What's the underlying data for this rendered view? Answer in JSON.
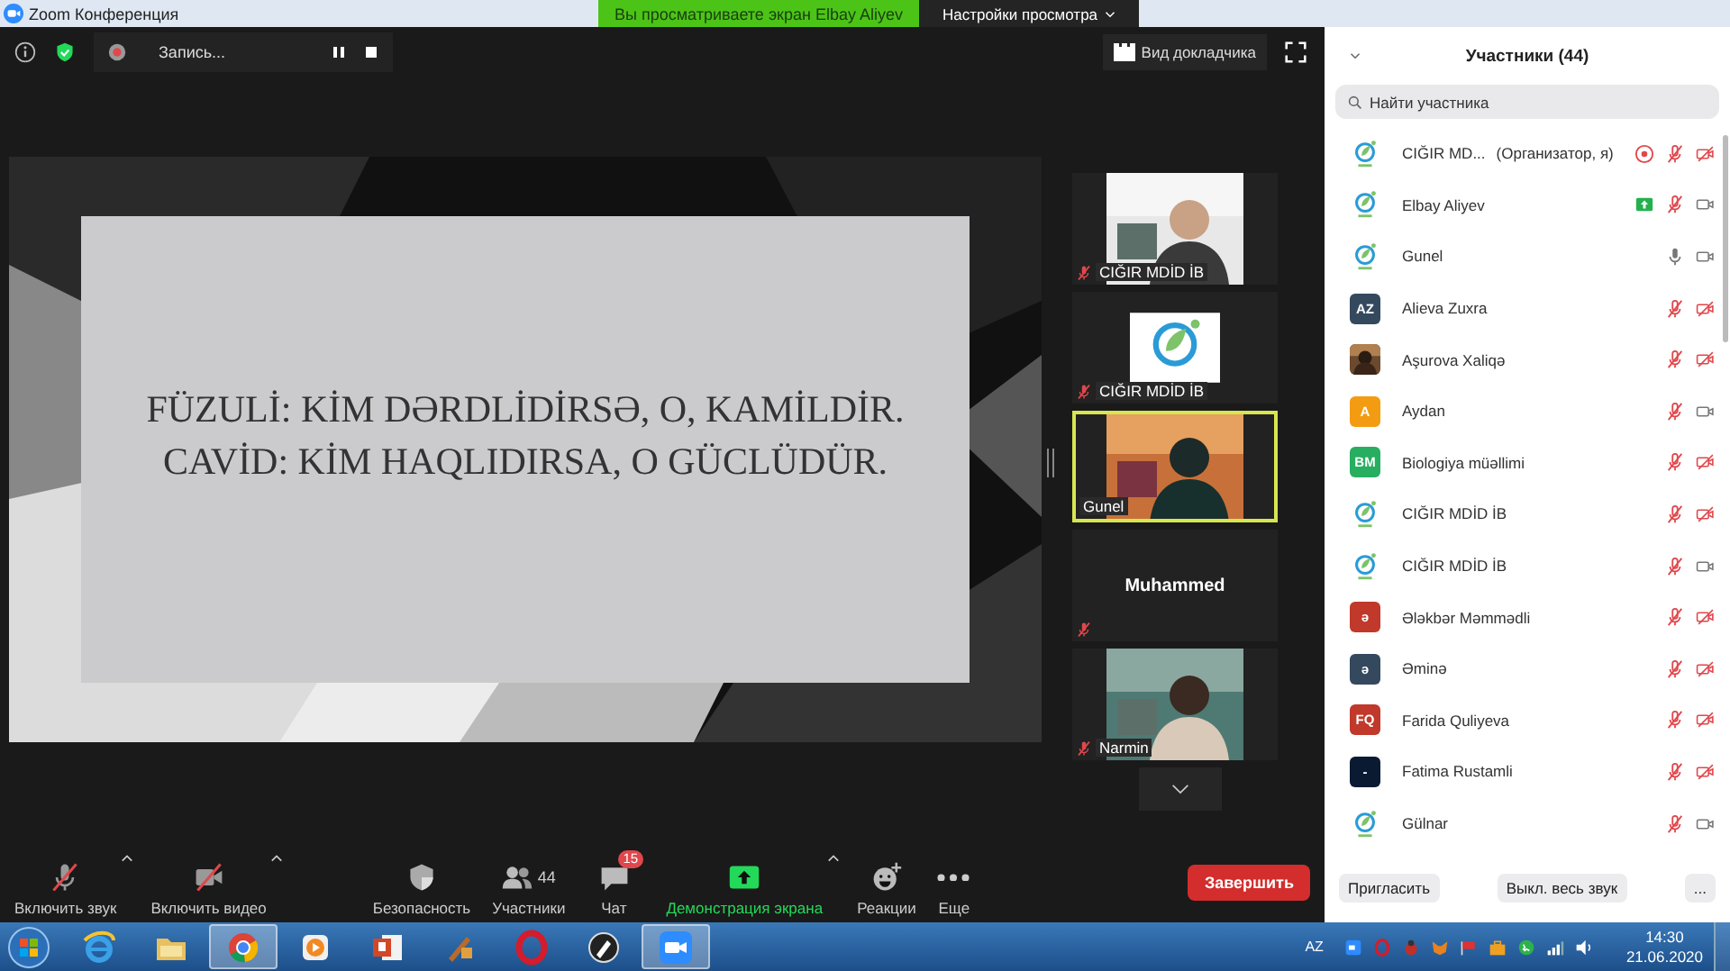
{
  "window": {
    "title": "Zoom Конференция"
  },
  "share_banner": {
    "text": "Вы просматриваете экран Elbay Aliyev",
    "view_options": "Настройки просмотра"
  },
  "meeting_bar": {
    "recording_label": "Запись...",
    "view_button": "Вид докладчика"
  },
  "shared_screen": {
    "lines": [
      "FÜZULİ: KİM DƏRDLİDİRSƏ, O, KAMİLDİR.",
      "CAVİD: KİM HAQLIDIRSA, O GÜCLÜDÜR."
    ]
  },
  "video_tiles": [
    {
      "kind": "video",
      "name": "CIĞIR MDİD İB",
      "muted": true,
      "active": false
    },
    {
      "kind": "logo",
      "name": "CIĞIR MDİD İB",
      "muted": true,
      "active": false
    },
    {
      "kind": "video",
      "name": "Gunel",
      "muted": false,
      "active": true
    },
    {
      "kind": "name",
      "name": "Muhammed",
      "muted": true,
      "active": false
    },
    {
      "kind": "video",
      "name": "Narmin",
      "muted": true,
      "active": false
    }
  ],
  "toolbar": [
    {
      "kind": "mic",
      "label": "Включить звук",
      "caret": true
    },
    {
      "kind": "camera",
      "label": "Включить видео",
      "caret": true
    },
    {
      "kind": "security",
      "label": "Безопасность",
      "caret": false
    },
    {
      "kind": "participants",
      "label": "Участники",
      "count": "44",
      "caret": false
    },
    {
      "kind": "chat",
      "label": "Чат",
      "badge": "15",
      "caret": false
    },
    {
      "kind": "share",
      "label": "Демонстрация экрана",
      "caret": true
    },
    {
      "kind": "reactions",
      "label": "Реакции",
      "caret": false
    },
    {
      "kind": "more",
      "label": "Еще",
      "caret": false
    }
  ],
  "end_button": "Завершить",
  "participants_panel": {
    "title": "Участники (44)",
    "search": {
      "placeholder": "Найти участника"
    },
    "items": [
      {
        "kind": "logo",
        "name": "CIĞIR MD...",
        "note": "(Организатор, я)",
        "recording": true,
        "sharing": false,
        "muted": true,
        "video_on": false
      },
      {
        "kind": "logo",
        "name": "Elbay Aliyev",
        "recording": false,
        "sharing": true,
        "muted": true,
        "video_on": true
      },
      {
        "kind": "logo",
        "name": "Gunel",
        "recording": false,
        "sharing": false,
        "muted": false,
        "video_on": true
      },
      {
        "kind": "initials",
        "initials": "AZ",
        "color": "#34495e",
        "name": "Alieva Zuxra",
        "recording": false,
        "sharing": false,
        "muted": true,
        "video_on": false
      },
      {
        "name": "Aşurova Xaliqə",
        "recording": false,
        "sharing": false,
        "muted": true,
        "video_on": false
      },
      {
        "kind": "initials",
        "initials": "A",
        "color": "#f39c12",
        "name": "Aydan",
        "recording": false,
        "sharing": false,
        "muted": true,
        "video_on": true
      },
      {
        "kind": "initials",
        "initials": "BM",
        "color": "#27ae60",
        "name": "Biologiya müəllimi",
        "recording": false,
        "sharing": false,
        "muted": true,
        "video_on": false
      },
      {
        "kind": "logo",
        "name": "CIĞIR MDİD İB",
        "recording": false,
        "sharing": false,
        "muted": true,
        "video_on": false
      },
      {
        "kind": "logo",
        "name": "CIĞIR MDİD İB",
        "recording": false,
        "sharing": false,
        "muted": true,
        "video_on": true
      },
      {
        "kind": "initials",
        "initials": "ə",
        "color": "#c0392b",
        "name": "Ələkbər Məmmədli",
        "recording": false,
        "sharing": false,
        "muted": true,
        "video_on": false
      },
      {
        "kind": "initials",
        "initials": "ə",
        "color": "#34495e",
        "name": "Əminə",
        "recording": false,
        "sharing": false,
        "muted": true,
        "video_on": false
      },
      {
        "kind": "initials",
        "initials": "FQ",
        "color": "#c0392b",
        "name": "Farida Quliyeva",
        "recording": false,
        "sharing": false,
        "muted": true,
        "video_on": false
      },
      {
        "kind": "initials",
        "initials": "-",
        "color": "#0b1a33",
        "name": "Fatima Rustamli",
        "recording": false,
        "sharing": false,
        "muted": true,
        "video_on": false
      },
      {
        "kind": "logo",
        "name": "Gülnar",
        "recording": false,
        "sharing": false,
        "muted": true,
        "video_on": true
      }
    ],
    "buttons": [
      "Пригласить",
      "Выкл. весь звук",
      "..."
    ]
  },
  "taskbar": {
    "apps": [
      {
        "kind": "ie",
        "active": false
      },
      {
        "kind": "folder",
        "active": false
      },
      {
        "kind": "chrome",
        "active": true
      },
      {
        "kind": "media",
        "active": false
      },
      {
        "kind": "powerpoint",
        "active": false
      },
      {
        "kind": "tool",
        "active": false
      },
      {
        "kind": "opera",
        "active": false
      },
      {
        "kind": "pen",
        "active": false
      },
      {
        "kind": "zoom",
        "active": true
      }
    ],
    "language": "AZ",
    "time": "14:30",
    "date": "21.06.2020"
  }
}
